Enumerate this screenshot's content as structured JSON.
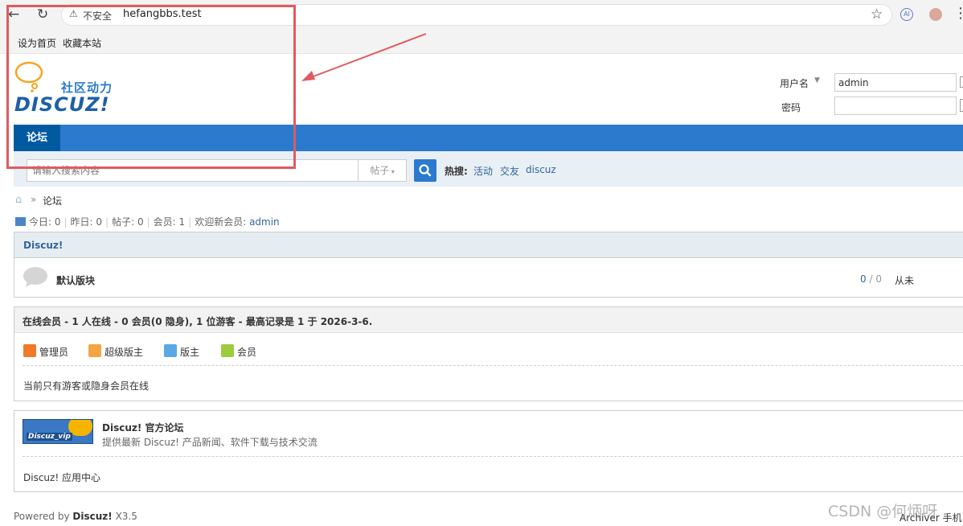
{
  "browser": {
    "security_label": "不安全",
    "url": "hefangbbs.test"
  },
  "bookmarks": [
    "设为首页",
    "收藏本站"
  ],
  "header": {
    "logo_cn": "社区动力",
    "logo_en": "DISCUZ!",
    "username_label": "用户名",
    "username_value": "admin",
    "password_label": "密码",
    "password_value": ""
  },
  "nav": {
    "forum": "论坛"
  },
  "search": {
    "placeholder": "请输入搜索内容",
    "type": "帖子",
    "hot_label": "热搜:",
    "hot_items": [
      "活动",
      "交友",
      "discuz"
    ]
  },
  "breadcrumb": {
    "sep": "»",
    "current": "论坛"
  },
  "stats": {
    "today": "今日: 0",
    "yesterday": "昨日: 0",
    "posts": "帖子: 0",
    "members": "会员: 1",
    "welcome": "欢迎新会员:",
    "new_member": "admin"
  },
  "forum_group": {
    "title": "Discuz!",
    "forum_name": "默认版块",
    "counts_a": "0",
    "counts_sep": "/",
    "counts_b": "0",
    "last_post": "从未"
  },
  "online": {
    "title": "在线会员 - 1 人在线 - 0 会员(0 隐身), 1 位游客 - 最高记录是 1 于 2026-3-6.",
    "legend": [
      {
        "label": "管理员",
        "color": "#f07a2a"
      },
      {
        "label": "超级版主",
        "color": "#f5a443"
      },
      {
        "label": "版主",
        "color": "#5aa8e6"
      },
      {
        "label": "会员",
        "color": "#9ccc3c"
      }
    ],
    "note": "当前只有游客或隐身会员在线"
  },
  "links": {
    "logo_text": "Discuz_vip",
    "title": "Discuz! 官方论坛",
    "desc": "提供最新 Discuz! 产品新闻、软件下载与技术交流",
    "app_center": "Discuz! 应用中心"
  },
  "footer": {
    "powered_prefix": "Powered by",
    "brand": "Discuz!",
    "version": "X3.5",
    "right": "Archiver  手机"
  },
  "watermark": "CSDN @何炳呀",
  "colors": {
    "nav_blue": "#2b7acd",
    "nav_active": "#005aa0",
    "annotation_red": "#e05a5f",
    "link": "#336699"
  }
}
